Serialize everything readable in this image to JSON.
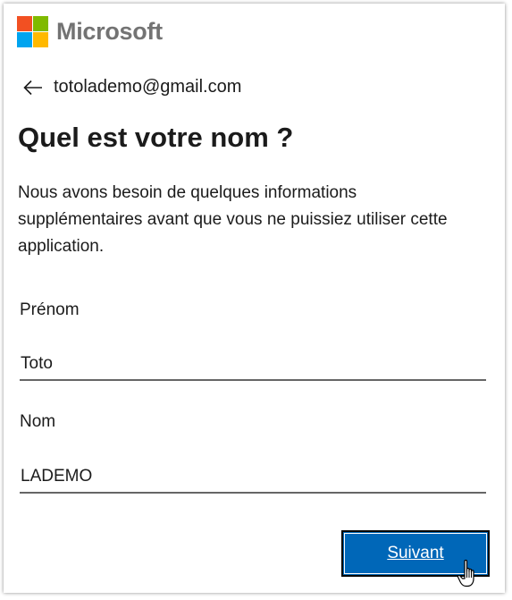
{
  "brand": {
    "name": "Microsoft",
    "colors": {
      "red": "#f25022",
      "green": "#7fba00",
      "blue": "#00a4ef",
      "yellow": "#ffb900",
      "text": "#737373"
    }
  },
  "identity": {
    "back_icon": "arrow-left-icon",
    "email": "totolademo@gmail.com"
  },
  "page": {
    "title": "Quel est votre nom ?",
    "description": "Nous avons besoin de quelques informations supplémentaires avant que vous ne puissiez utiliser cette application."
  },
  "form": {
    "first_name": {
      "label": "Prénom",
      "value": "Toto"
    },
    "last_name": {
      "label": "Nom",
      "value": "LADEMO"
    }
  },
  "actions": {
    "next_label": "Suivant",
    "accent_color": "#0067b8"
  },
  "cursor": {
    "icon": "hand-pointer-icon"
  }
}
